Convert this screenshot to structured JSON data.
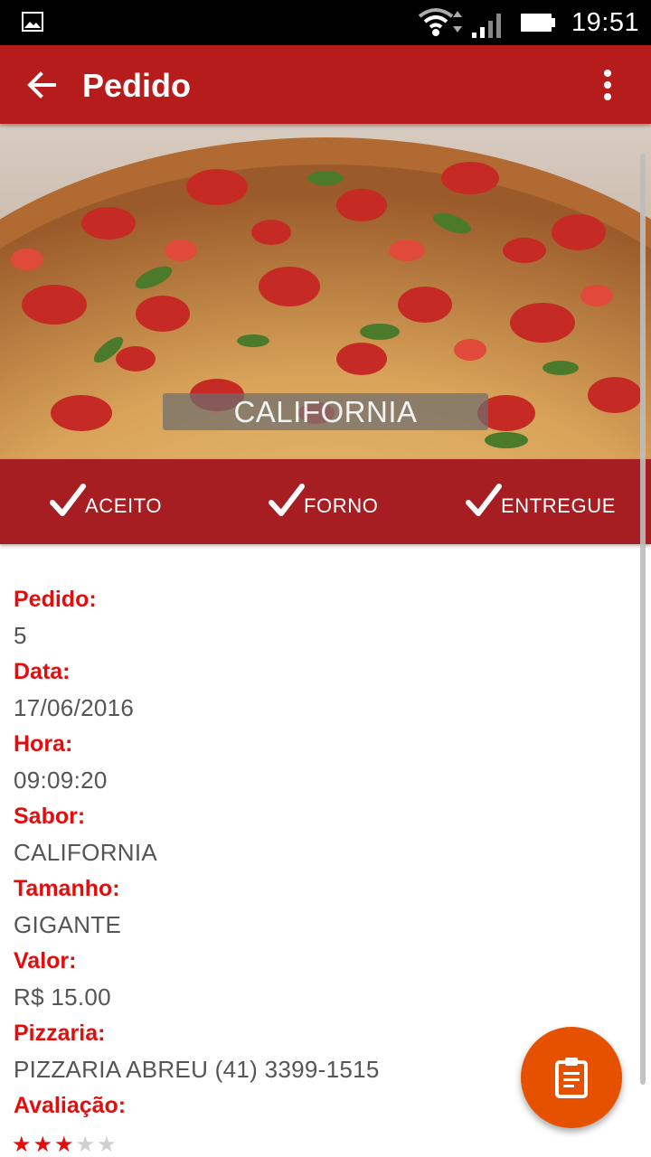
{
  "status_bar": {
    "time": "19:51",
    "icons": [
      "gallery-icon",
      "wifi-icon",
      "signal-icon",
      "battery-icon"
    ]
  },
  "app_bar": {
    "title": "Pedido",
    "back_icon": "arrow-back-icon",
    "menu_icon": "more-vert-icon",
    "color": "#b71c1c"
  },
  "hero": {
    "caption": "CALIFORNIA"
  },
  "order_steps": [
    {
      "label": "ACEITO",
      "icon": "check-icon"
    },
    {
      "label": "FORNO",
      "icon": "check-icon"
    },
    {
      "label": "ENTREGUE",
      "icon": "check-icon"
    }
  ],
  "details": [
    {
      "label": "Pedido:",
      "value": "5"
    },
    {
      "label": "Data:",
      "value": "17/06/2016"
    },
    {
      "label": "Hora:",
      "value": "09:09:20"
    },
    {
      "label": "Sabor:",
      "value": "CALIFORNIA"
    },
    {
      "label": "Tamanho:",
      "value": "GIGANTE"
    },
    {
      "label": "Valor:",
      "value": "R$ 15.00"
    },
    {
      "label": "Pizzaria:",
      "value": "PIZZARIA ABREU (41) 3399-1515"
    },
    {
      "label": "Avaliação:",
      "value": ""
    }
  ],
  "rating": {
    "value": 3,
    "max": 5
  },
  "fab": {
    "icon": "clipboard-icon",
    "color": "#e65100"
  },
  "colors": {
    "accent_text": "#e40d0d",
    "strip": "#a61e22"
  }
}
